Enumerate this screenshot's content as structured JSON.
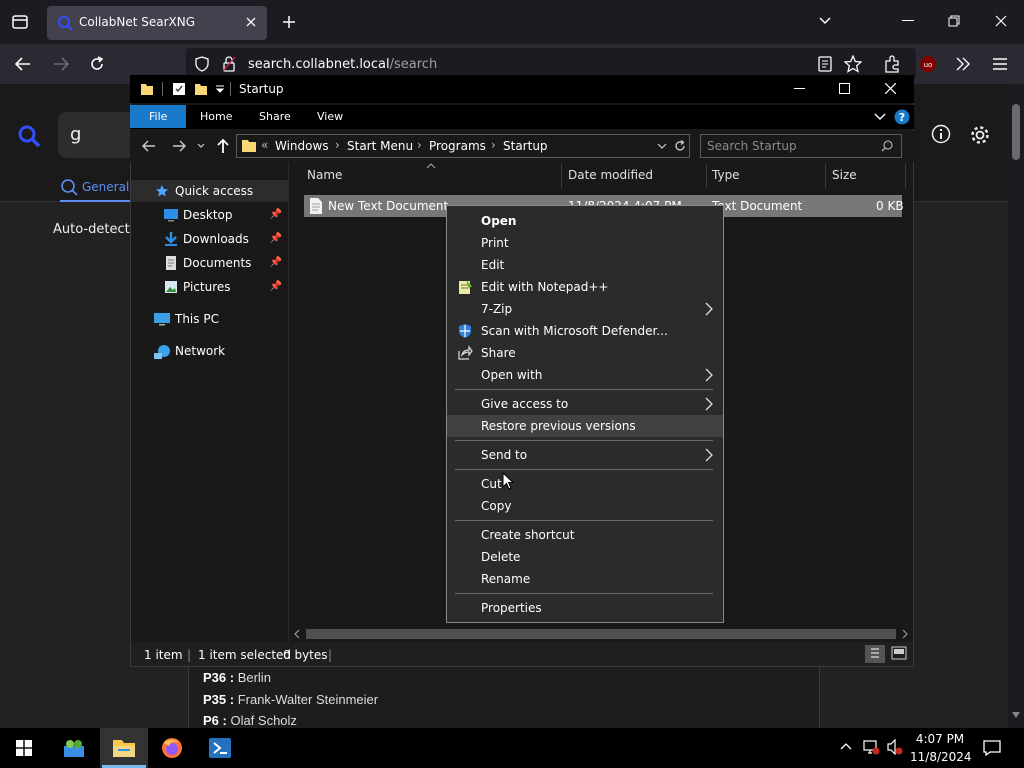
{
  "browser": {
    "tab_title": "CollabNet SearXNG",
    "url_host": "search.collabnet.local",
    "url_path": "/search"
  },
  "webpage": {
    "search_value": "g",
    "tab_general": "General",
    "autodetect": "Auto-detect (",
    "results": [
      {
        "key": "P36 :",
        "value": " Berlin"
      },
      {
        "key": "P35 :",
        "value": " Frank-Walter Steinmeier"
      },
      {
        "key": "P6 :",
        "value": " Olaf Scholz"
      }
    ]
  },
  "explorer": {
    "title": "Startup",
    "ribbon": {
      "file": "File",
      "home": "Home",
      "share": "Share",
      "view": "View"
    },
    "breadcrumb": {
      "prefix": "«",
      "items": [
        "Windows",
        "Start Menu",
        "Programs",
        "Startup"
      ]
    },
    "search_placeholder": "Search Startup",
    "nav": {
      "quick_access": "Quick access",
      "desktop": "Desktop",
      "downloads": "Downloads",
      "documents": "Documents",
      "pictures": "Pictures",
      "this_pc": "This PC",
      "network": "Network"
    },
    "columns": {
      "name": "Name",
      "date": "Date modified",
      "type": "Type",
      "size": "Size"
    },
    "file": {
      "name": "New Text Document",
      "date": "11/8/2024 4:07 PM",
      "type": "Text Document",
      "size": "0 KB"
    },
    "status": {
      "count": "1 item",
      "selected": "1 item selected",
      "bytes": "0 bytes"
    }
  },
  "context_menu": {
    "open": "Open",
    "print": "Print",
    "edit": "Edit",
    "edit_notepad": "Edit with Notepad++",
    "zip": "7-Zip",
    "defender": "Scan with Microsoft Defender...",
    "share": "Share",
    "open_with": "Open with",
    "give_access": "Give access to",
    "restore": "Restore previous versions",
    "send_to": "Send to",
    "cut": "Cut",
    "copy": "Copy",
    "create_shortcut": "Create shortcut",
    "delete": "Delete",
    "rename": "Rename",
    "properties": "Properties"
  },
  "taskbar": {
    "time": "4:07 PM",
    "date": "11/8/2024"
  },
  "colors": {
    "accent": "#1979ca",
    "menu_bg": "#2b2b2b",
    "selection": "#777777"
  }
}
